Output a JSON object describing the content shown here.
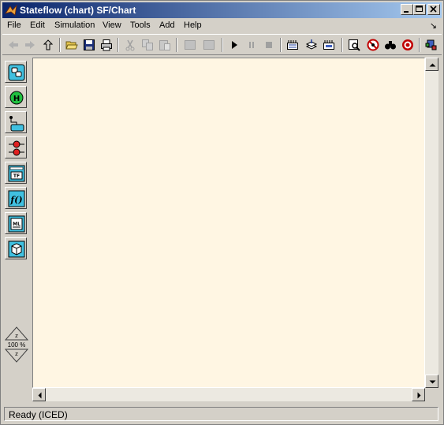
{
  "window": {
    "title": "Stateflow (chart) SF/Chart",
    "icon": "matlab-logo-icon"
  },
  "title_buttons": [
    "minimize-icon",
    "maximize-icon",
    "close-icon"
  ],
  "menu": {
    "file": "File",
    "edit": "Edit",
    "simulation": "Simulation",
    "view": "View",
    "tools": "Tools",
    "add": "Add",
    "help": "Help",
    "overflow_arrow": "↘"
  },
  "toolbar": {
    "icons": [
      "back-arrow-icon",
      "forward-arrow-icon",
      "up-arrow-icon",
      "open-folder-icon",
      "save-icon",
      "print-icon",
      "cut-icon",
      "copy-icon",
      "paste-icon",
      "undo-icon",
      "redo-icon",
      "start-icon",
      "pause-icon",
      "stop-icon",
      "build-icon",
      "rebuild-icon",
      "explorer-icon",
      "debug-icon",
      "no-parse-icon",
      "find-icon",
      "target-icon",
      "model-icon"
    ]
  },
  "palette": {
    "tools": [
      "state-tool-icon",
      "history-junction-icon",
      "default-transition-icon",
      "connective-junction-icon",
      "truth-table-icon",
      "function-icon",
      "embedded-matlab-icon",
      "box-icon"
    ],
    "zoom_label": "100 %"
  },
  "status": {
    "text": "Ready (ICED)"
  },
  "colors": {
    "canvas": "#fff6e3",
    "title_start": "#0a246a",
    "title_end": "#a6caf0",
    "chrome": "#d4d0c8"
  }
}
